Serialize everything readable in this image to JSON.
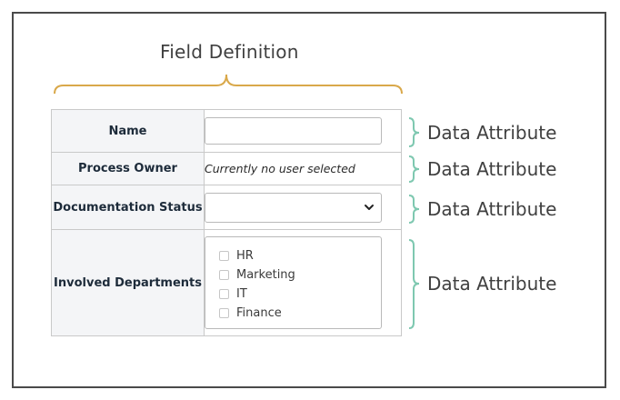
{
  "diagram": {
    "title": "Field Definition",
    "attribute_label": "Data Attribute"
  },
  "form": {
    "rows": [
      {
        "label": "Name",
        "value": ""
      },
      {
        "label": "Process Owner",
        "value": "Currently no user selected"
      },
      {
        "label": "Documentation Status",
        "value": ""
      },
      {
        "label": "Involved Departments",
        "options": [
          "HR",
          "Marketing",
          "IT",
          "Finance"
        ]
      }
    ]
  },
  "colors": {
    "field_bracket": "#d9a84a",
    "attribute_bracket": "#7ec8b0",
    "label_bg": "#f4f5f7",
    "border": "#c9c9c9"
  },
  "icons": {
    "dropdown": "chevron-down-icon",
    "checkbox": "checkbox-icon"
  }
}
